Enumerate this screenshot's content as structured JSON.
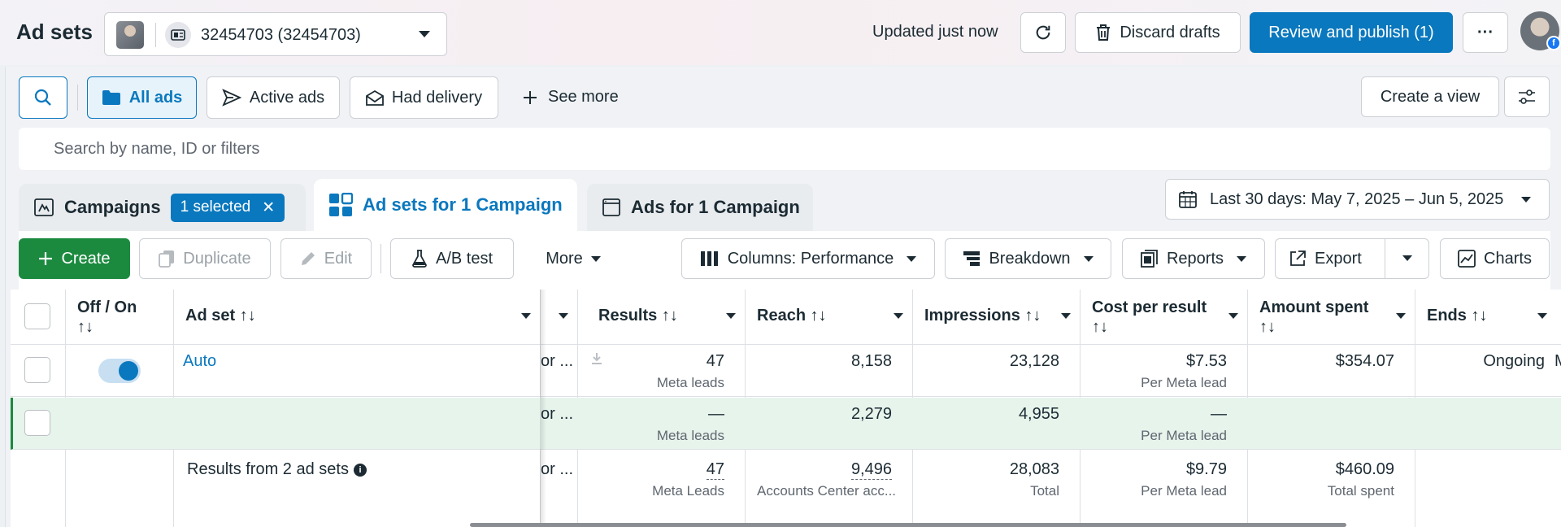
{
  "header": {
    "title": "Ad sets",
    "account": "32454703 (32454703)",
    "updated": "Updated just now",
    "discard_label": "Discard drafts",
    "publish_label": "Review and publish (1)",
    "more_label": "···"
  },
  "filters": {
    "all_ads": "All ads",
    "active_ads": "Active ads",
    "had_delivery": "Had delivery",
    "see_more": "See more",
    "create_view": "Create a view",
    "search_placeholder": "Search by name, ID or filters"
  },
  "tabs": {
    "campaigns": "Campaigns",
    "selected_badge": "1 selected",
    "adsets": "Ad sets for 1 Campaign",
    "ads": "Ads for 1 Campaign"
  },
  "date_range": "Last 30 days: May 7, 2025 – Jun 5, 2025",
  "toolbar": {
    "create": "Create",
    "duplicate": "Duplicate",
    "edit": "Edit",
    "ab_test": "A/B test",
    "more": "More",
    "columns": "Columns: Performance",
    "breakdown": "Breakdown",
    "reports": "Reports",
    "export": "Export",
    "charts": "Charts"
  },
  "table": {
    "headers": {
      "offon": "Off / On",
      "sort": "↑↓",
      "adset": "Ad set",
      "results": "Results",
      "reach": "Reach",
      "impressions": "Impressions",
      "cpr": "Cost per result",
      "spent": "Amount spent",
      "ends": "Ends"
    },
    "rows": [
      {
        "name": "Auto",
        "truncated": "or ...",
        "results": "47",
        "results_sub": "Meta leads",
        "reach": "8,158",
        "impressions": "23,128",
        "cpr": "$7.53",
        "cpr_sub": "Per Meta lead",
        "spent": "$354.07",
        "ends": "Ongoing",
        "next": "M"
      },
      {
        "name": "",
        "truncated": "or ...",
        "results": "—",
        "results_sub": "Meta leads",
        "reach": "2,279",
        "impressions": "4,955",
        "cpr": "—",
        "cpr_sub": "Per Meta lead",
        "spent": "",
        "ends": ""
      }
    ],
    "summary": {
      "label": "Results from 2 ad sets",
      "truncated": "or ...",
      "results": "47",
      "results_sub": "Meta Leads",
      "reach": "9,496",
      "reach_sub": "Accounts Center acc...",
      "impressions": "28,083",
      "impressions_sub": "Total",
      "cpr": "$9.79",
      "cpr_sub": "Per Meta lead",
      "spent": "$460.09",
      "spent_sub": "Total spent"
    }
  },
  "colors": {
    "accent": "#0a78be",
    "create_green": "#1b8a3f",
    "selected_row": "#e6f4ec"
  }
}
